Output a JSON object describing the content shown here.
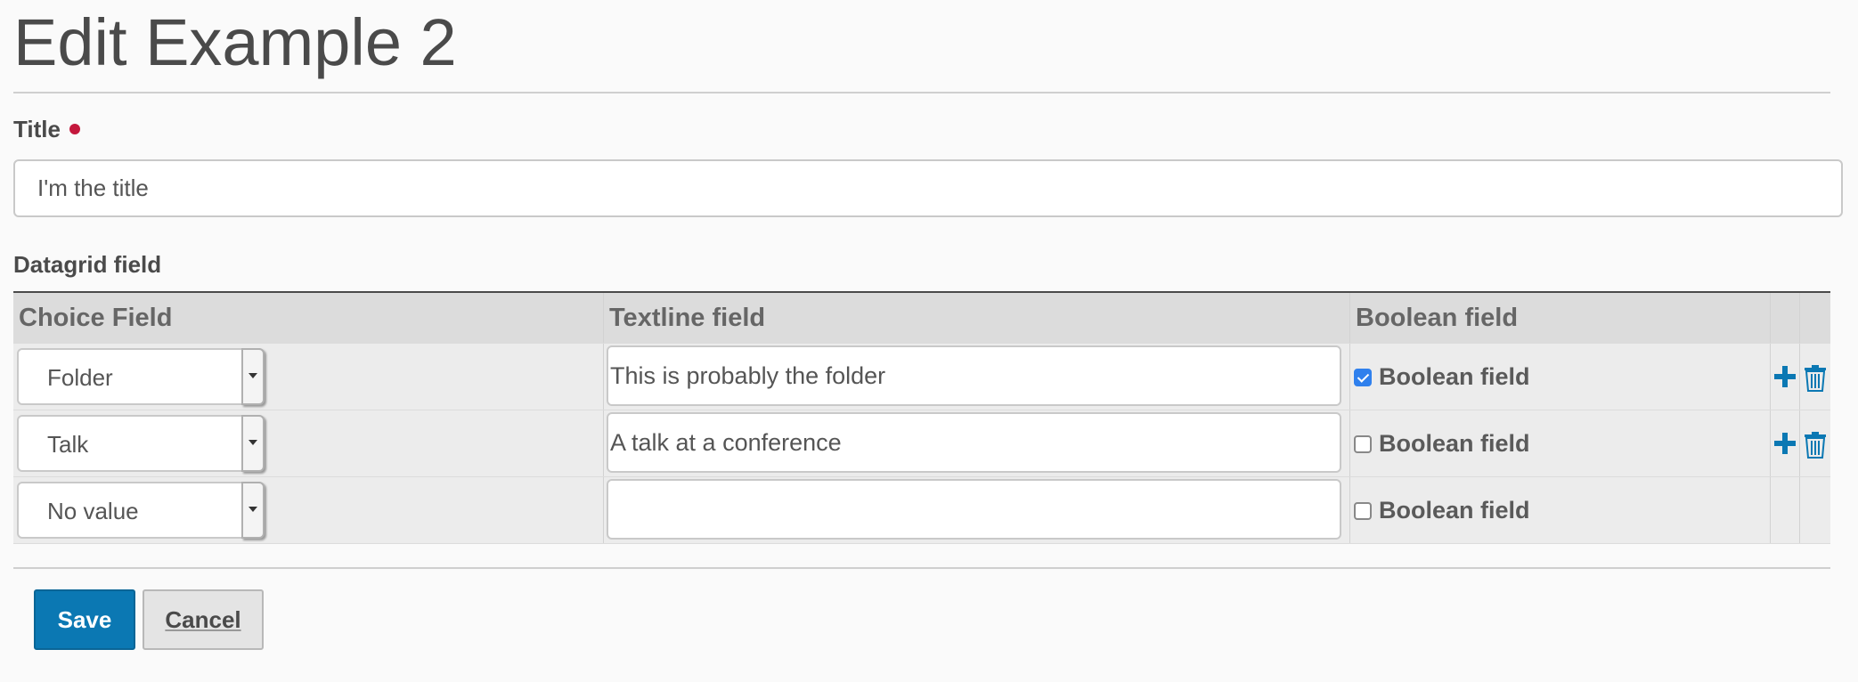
{
  "page": {
    "title": "Edit Example 2"
  },
  "title_field": {
    "label": "Title",
    "value": "I'm the title"
  },
  "datagrid": {
    "label": "Datagrid field",
    "headers": [
      "Choice Field",
      "Textline field",
      "Boolean field"
    ],
    "rows": [
      {
        "choice": "Folder",
        "text": "This is probably the folder",
        "bool_label": "Boolean field",
        "checked": true
      },
      {
        "choice": "Talk",
        "text": "A talk at a conference",
        "bool_label": "Boolean field",
        "checked": false
      },
      {
        "choice": "No value",
        "text": "",
        "bool_label": "Boolean field",
        "checked": false
      }
    ]
  },
  "actions": {
    "save": "Save",
    "cancel": "Cancel"
  },
  "colors": {
    "accent": "#0b78b3",
    "required": "#c4183c",
    "checkbox": "#2f80ed"
  },
  "icons": {
    "add": "plus-icon",
    "delete": "trash-icon",
    "dropdown": "caret-down-icon"
  }
}
